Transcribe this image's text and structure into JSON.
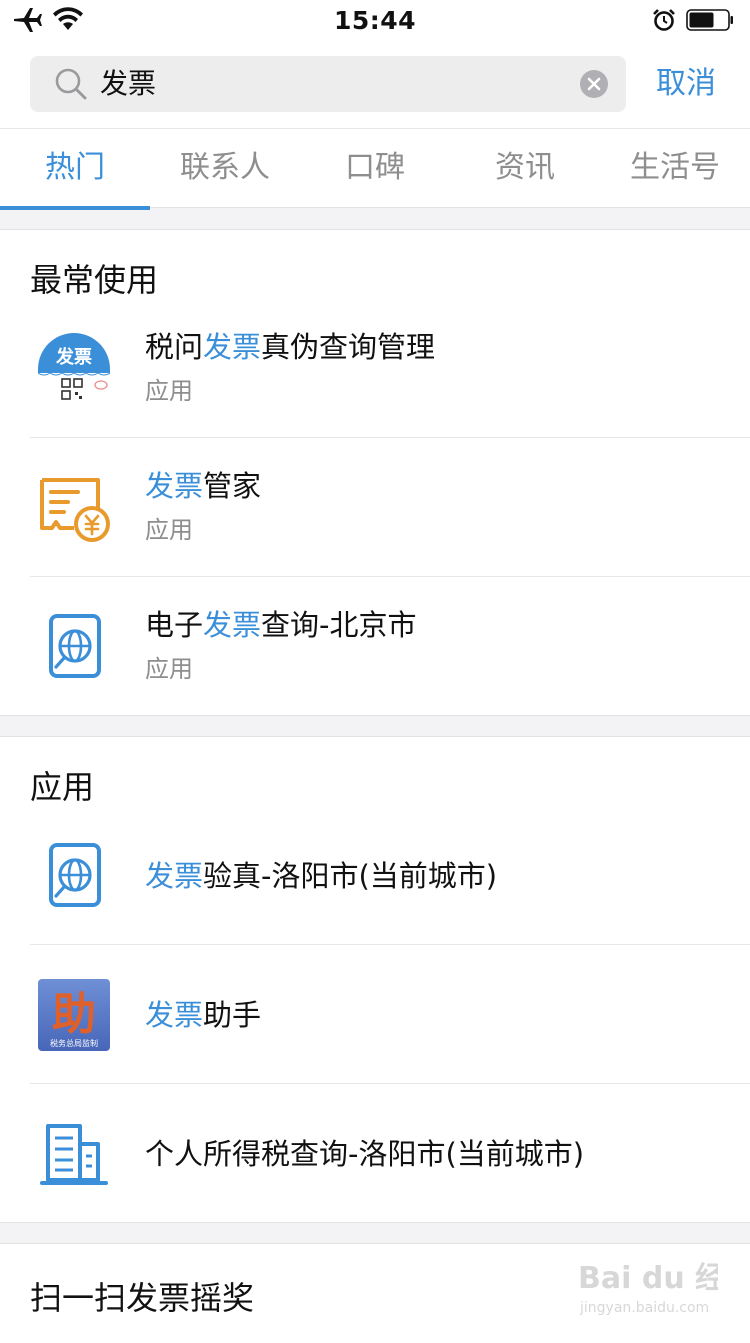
{
  "status_bar": {
    "time": "15:44"
  },
  "search": {
    "query": "发票",
    "cancel_label": "取消"
  },
  "tabs": [
    {
      "label": "热门",
      "active": true
    },
    {
      "label": "联系人"
    },
    {
      "label": "口碑"
    },
    {
      "label": "资讯"
    },
    {
      "label": "生活号"
    }
  ],
  "frequent": {
    "title": "最常使用",
    "items": [
      {
        "pre": "税问",
        "hl": "发票",
        "post": "真伪查询管理",
        "sub": "应用",
        "icon": "fapiao-qr-icon",
        "icon_text": "发票"
      },
      {
        "pre": "",
        "hl": "发票",
        "post": "管家",
        "sub": "应用",
        "icon": "invoice-yuan-icon"
      },
      {
        "pre": "电子",
        "hl": "发票",
        "post": "查询-北京市",
        "sub": "应用",
        "icon": "globe-doc-icon"
      }
    ]
  },
  "apps": {
    "title": "应用",
    "items": [
      {
        "pre": "",
        "hl": "发票",
        "post": "验真-洛阳市(当前城市)",
        "icon": "globe-doc-icon"
      },
      {
        "pre": "",
        "hl": "发票",
        "post": "助手",
        "icon": "zhu-assistant-icon",
        "icon_text": "助",
        "icon_subtext": "税务总局监制"
      },
      {
        "pre": "个人所得税查询-洛阳市(当前城市)",
        "hl": "",
        "post": "",
        "icon": "building-icon"
      }
    ]
  },
  "lottery": {
    "title": "扫一扫发票摇奖"
  },
  "watermark": {
    "text": "Bai du 经验",
    "sub": "jingyan.baidu.com"
  },
  "colors": {
    "accent": "#3b8fd9",
    "orange": "#e99a2c",
    "background": "#f3f3f5"
  }
}
